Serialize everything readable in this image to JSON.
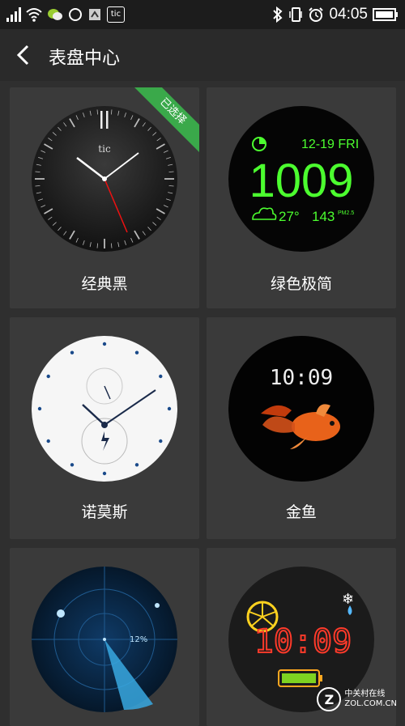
{
  "status_bar": {
    "time": "04:05",
    "tic_badge": "tic"
  },
  "header": {
    "title": "表盘中心"
  },
  "watch_faces": [
    {
      "name": "经典黑",
      "selected": true,
      "selected_badge": "已选择",
      "brand_mark": "tic"
    },
    {
      "name": "绿色极简",
      "date": "12-19 FRI",
      "time": "1009",
      "temperature": "27°",
      "aqi": "143",
      "aqi_unit": "PM2.5"
    },
    {
      "name": "诺莫斯"
    },
    {
      "name": "金鱼",
      "time": "10:09"
    },
    {
      "name": "",
      "percent": "12%"
    },
    {
      "name": "",
      "time": "10:09"
    }
  ],
  "watermark": {
    "cn": "中关村在线",
    "en": "ZOL.COM.CN"
  },
  "colors": {
    "accent_green": "#3aa94a",
    "minimal_green": "#4cff2f",
    "background": "#2f2f2f",
    "card": "#3a3a3a"
  }
}
